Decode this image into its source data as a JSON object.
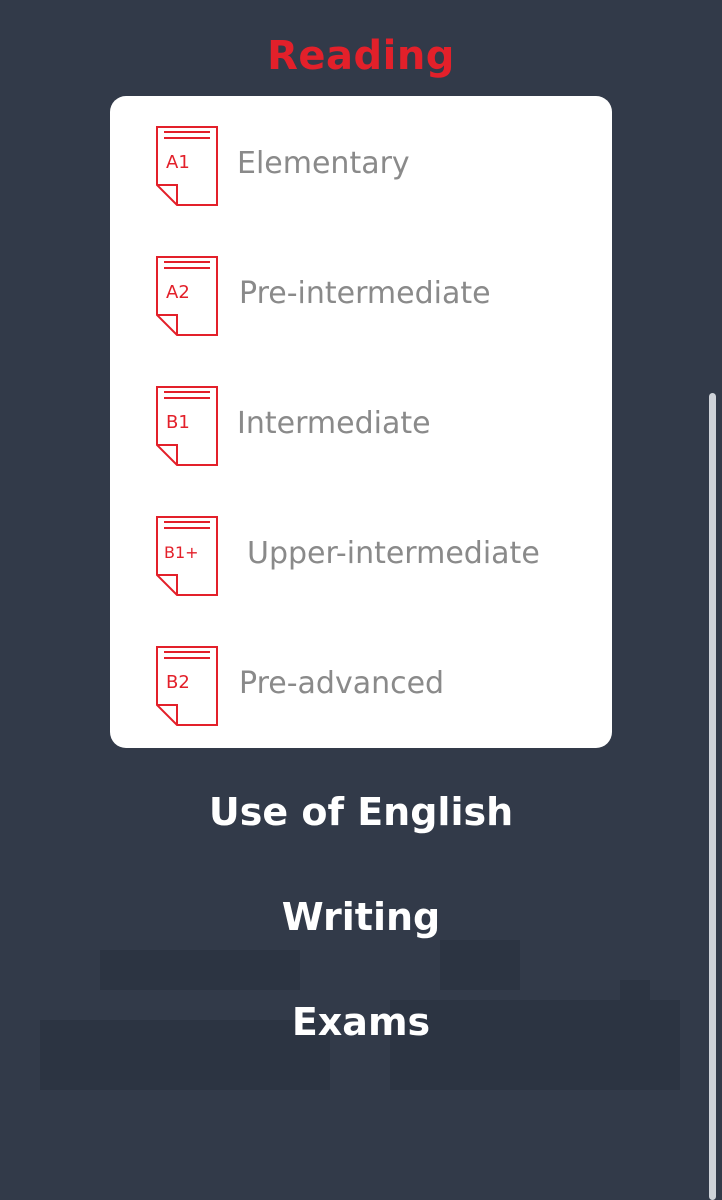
{
  "section": {
    "title": "Reading"
  },
  "levels": [
    {
      "code": "A1",
      "label": "Elementary"
    },
    {
      "code": "A2",
      "label": "Pre-intermediate"
    },
    {
      "code": "B1",
      "label": "Intermediate"
    },
    {
      "code": "B1+",
      "label": "Upper-intermediate"
    },
    {
      "code": "B2",
      "label": "Pre-advanced"
    }
  ],
  "menu": {
    "use_of_english": "Use of English",
    "writing": "Writing",
    "exams": "Exams"
  },
  "colors": {
    "accent": "#e3202a",
    "background": "#323a49",
    "card": "#ffffff",
    "label": "#8a8a8a"
  },
  "icons": {
    "level_icon": "document-icon"
  }
}
